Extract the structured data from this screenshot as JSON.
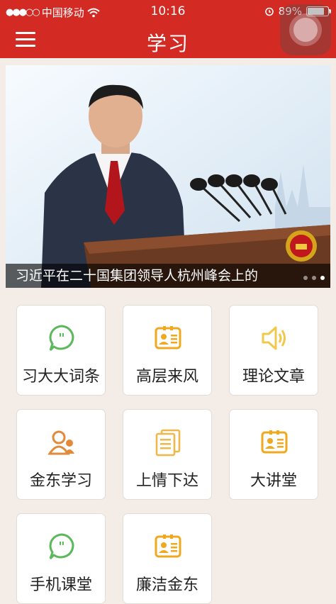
{
  "status_bar": {
    "carrier": "中国移动",
    "time": "10:16",
    "battery": "89%",
    "battery_level": 0.89
  },
  "header": {
    "title": "学习"
  },
  "banner": {
    "caption": "习近平在二十国集团领导人杭州峰会上的"
  },
  "tiles": [
    {
      "label": "习大大词条",
      "icon": "speech-bubble-icon",
      "color": "#5cb85c"
    },
    {
      "label": "高层来风",
      "icon": "id-card-icon",
      "color": "#f0a81e"
    },
    {
      "label": "理论文章",
      "icon": "speaker-icon",
      "color": "#f0c84a"
    },
    {
      "label": "金东学习",
      "icon": "people-icon",
      "color": "#e38a3a"
    },
    {
      "label": "上情下达",
      "icon": "documents-icon",
      "color": "#f0b84a"
    },
    {
      "label": "大讲堂",
      "icon": "id-card-icon",
      "color": "#f0a81e"
    },
    {
      "label": "手机课堂",
      "icon": "speech-bubble-icon",
      "color": "#5cb85c"
    },
    {
      "label": "廉洁金东",
      "icon": "id-card-icon",
      "color": "#f0a81e"
    }
  ]
}
